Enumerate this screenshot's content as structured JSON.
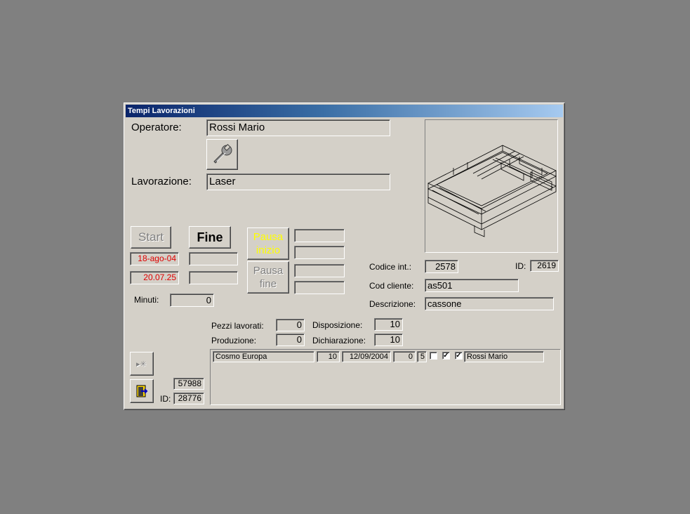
{
  "window": {
    "title": "Tempi Lavorazioni"
  },
  "operatore": {
    "label": "Operatore:",
    "value": "Rossi Mario"
  },
  "lavorazione": {
    "label": "Lavorazione:",
    "value": "Laser"
  },
  "tool_button": {
    "icon": "wrench-icon"
  },
  "buttons": {
    "start": "Start",
    "fine": "Fine",
    "pausa_inizio": "Pausa inizio",
    "pausa_fine": "Pausa fine"
  },
  "start_date": "18-ago-04",
  "start_time": "20.07.25",
  "end_date": "",
  "end_time": "",
  "pausa_inizio_values": [
    "",
    ""
  ],
  "pausa_fine_values": [
    "",
    ""
  ],
  "minuti": {
    "label": "Minuti:",
    "value": "0"
  },
  "codice_int": {
    "label": "Codice  int.:",
    "value": "2578"
  },
  "id_top": {
    "label": "ID:",
    "value": "2619"
  },
  "cod_cliente": {
    "label": "Cod cliente:",
    "value": "as501"
  },
  "descrizione": {
    "label": "Descrizione:",
    "value": "cassone"
  },
  "pezzi_lavorati": {
    "label": "Pezzi lavorati:",
    "value": "0"
  },
  "produzione": {
    "label": "Produzione:",
    "value": "0"
  },
  "disposizione": {
    "label": "Disposizione:",
    "value": "10"
  },
  "dichiarazione": {
    "label": "Dichiarazione:",
    "value": "10"
  },
  "record_count": "57988",
  "id_bottom": {
    "label": "ID:",
    "value": "28776"
  },
  "subform_row": {
    "cliente": "Cosmo Europa",
    "quantita": "10",
    "data": "12/09/2004",
    "valore1": "0",
    "valore2": "5",
    "check1": false,
    "check2": true,
    "check3": true,
    "operatore": "Rossi Mario"
  },
  "colors": {
    "red_text": "#e00000",
    "yellow_text": "#ffff00",
    "title_start": "#0a246a",
    "title_end": "#a6caf0"
  }
}
